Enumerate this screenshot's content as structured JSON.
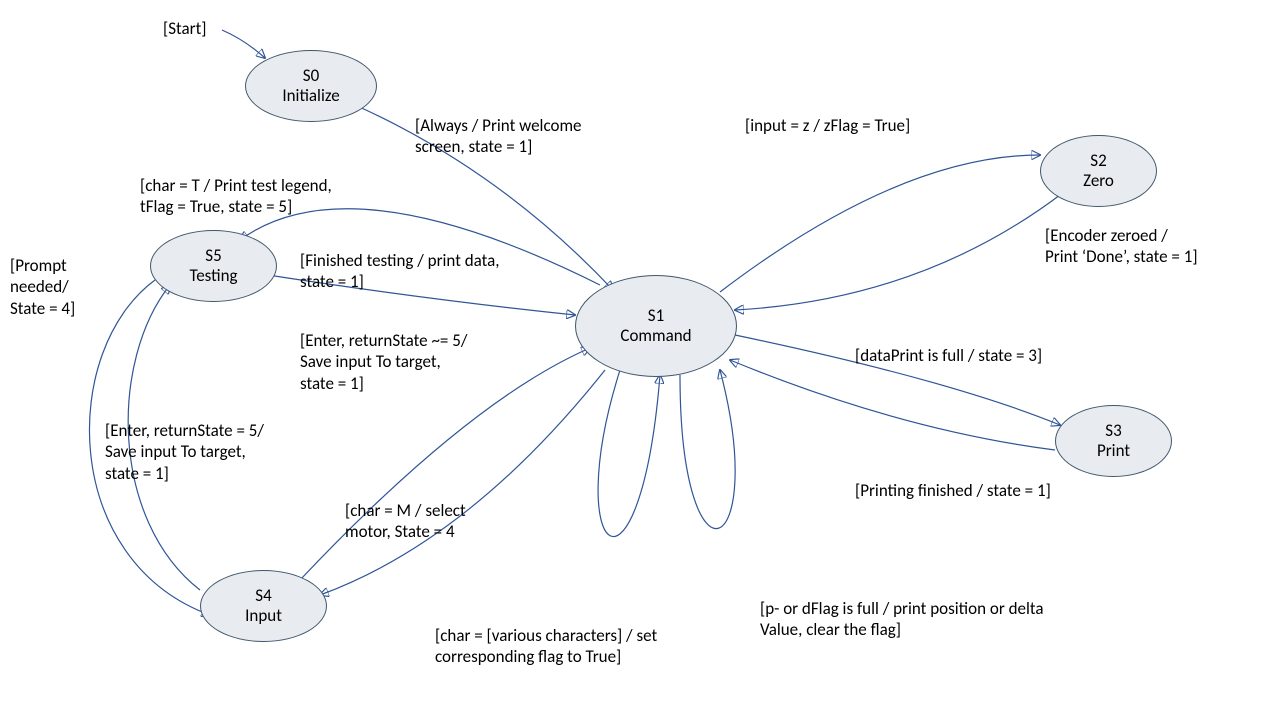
{
  "diagram_type": "state-machine",
  "start_label": "[Start]",
  "states": {
    "s0": {
      "id": "S0",
      "name": "Initialize"
    },
    "s1": {
      "id": "S1",
      "name": "Command"
    },
    "s2": {
      "id": "S2",
      "name": "Zero"
    },
    "s3": {
      "id": "S3",
      "name": "Print"
    },
    "s4": {
      "id": "S4",
      "name": "Input"
    },
    "s5": {
      "id": "S5",
      "name": "Testing"
    }
  },
  "transitions": {
    "start_s0": "[Start]",
    "s0_s1": "[Always / Print welcome\nscreen, state = 1]",
    "s1_s2": "[input = z / zFlag = True]",
    "s2_s1": "[Encoder zeroed /\nPrint ‘Done’, state = 1]",
    "s1_s3": "[dataPrint is full / state = 3]",
    "s3_s1": "[Printing finished / state = 1]",
    "s1_s5": "[char = T / Print test legend,\ntFlag = True, state = 5]",
    "s5_s1": "[Finished testing / print data,\nstate = 1]",
    "s5_s4_prompt": "[Prompt\nneeded/\nState = 4]",
    "s4_s1_not5": "[Enter, returnState ~= 5/\nSave input To target,\nstate = 1]",
    "s4_s5_eq5": "[Enter, returnState = 5/\nSave input To target,\nstate = 1]",
    "s1_s4_motor": "[char = M / select\nmotor, State = 4",
    "s1_self_char": "[char = [various characters] / set\ncorresponding flag to True]",
    "s1_self_flag": "[p- or dFlag is full / print position or delta\nValue, clear the flag]"
  },
  "chart_data": {
    "type": "state_diagram",
    "states": [
      "S0 Initialize",
      "S1 Command",
      "S2 Zero",
      "S3 Print",
      "S4 Input",
      "S5 Testing"
    ],
    "initial": "S0",
    "edges": [
      {
        "from": "START",
        "to": "S0",
        "label": "[Start]"
      },
      {
        "from": "S0",
        "to": "S1",
        "label": "[Always / Print welcome screen, state = 1]"
      },
      {
        "from": "S1",
        "to": "S2",
        "label": "[input = z / zFlag = True]"
      },
      {
        "from": "S2",
        "to": "S1",
        "label": "[Encoder zeroed / Print 'Done', state = 1]"
      },
      {
        "from": "S1",
        "to": "S3",
        "label": "[dataPrint is full / state = 3]"
      },
      {
        "from": "S3",
        "to": "S1",
        "label": "[Printing finished / state = 1]"
      },
      {
        "from": "S1",
        "to": "S5",
        "label": "[char = T / Print test legend, tFlag = True, state = 5]"
      },
      {
        "from": "S5",
        "to": "S1",
        "label": "[Finished testing / print data, state = 1]"
      },
      {
        "from": "S5",
        "to": "S4",
        "label": "[Prompt needed / State = 4]"
      },
      {
        "from": "S4",
        "to": "S5",
        "label": "[Enter, returnState = 5 / Save input To target, state = 1]"
      },
      {
        "from": "S4",
        "to": "S1",
        "label": "[Enter, returnState ~= 5 / Save input To target, state = 1]"
      },
      {
        "from": "S1",
        "to": "S4",
        "label": "[char = M / select motor, State = 4"
      },
      {
        "from": "S1",
        "to": "S1",
        "label": "[char = [various characters] / set corresponding flag to True]"
      },
      {
        "from": "S1",
        "to": "S1",
        "label": "[p- or dFlag is full / print position or delta Value, clear the flag]"
      }
    ]
  }
}
